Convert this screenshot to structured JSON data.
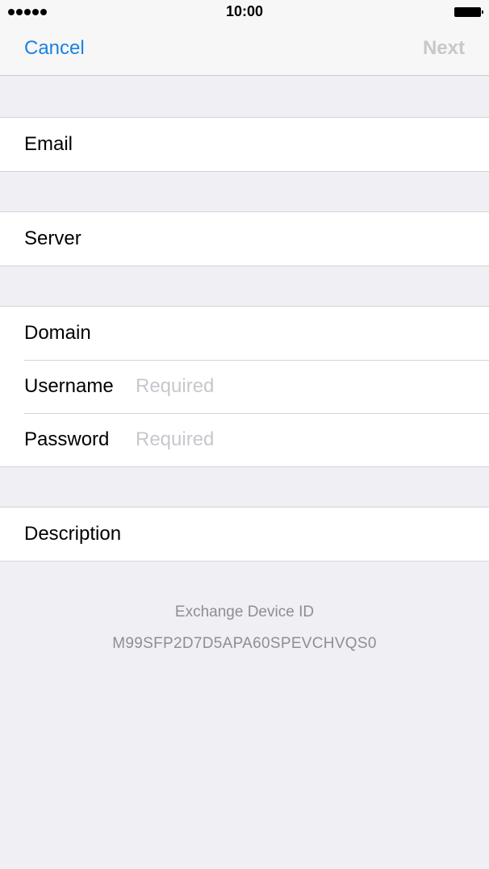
{
  "status_bar": {
    "time": "10:00"
  },
  "nav": {
    "cancel_label": "Cancel",
    "next_label": "Next"
  },
  "form": {
    "email": {
      "label": "Email",
      "placeholder": ""
    },
    "server": {
      "label": "Server",
      "placeholder": ""
    },
    "domain": {
      "label": "Domain",
      "placeholder": ""
    },
    "username": {
      "label": "Username",
      "placeholder": "Required"
    },
    "password": {
      "label": "Password",
      "placeholder": "Required"
    },
    "description": {
      "label": "Description",
      "placeholder": ""
    }
  },
  "footer": {
    "title": "Exchange Device ID",
    "device_id": "M99SFP2D7D5APA60SPEVCHVQS0"
  },
  "colors": {
    "accent": "#1a82e2",
    "disabled": "#c7c7cc",
    "background": "#efeff4",
    "footer_text": "#8e8e93"
  }
}
